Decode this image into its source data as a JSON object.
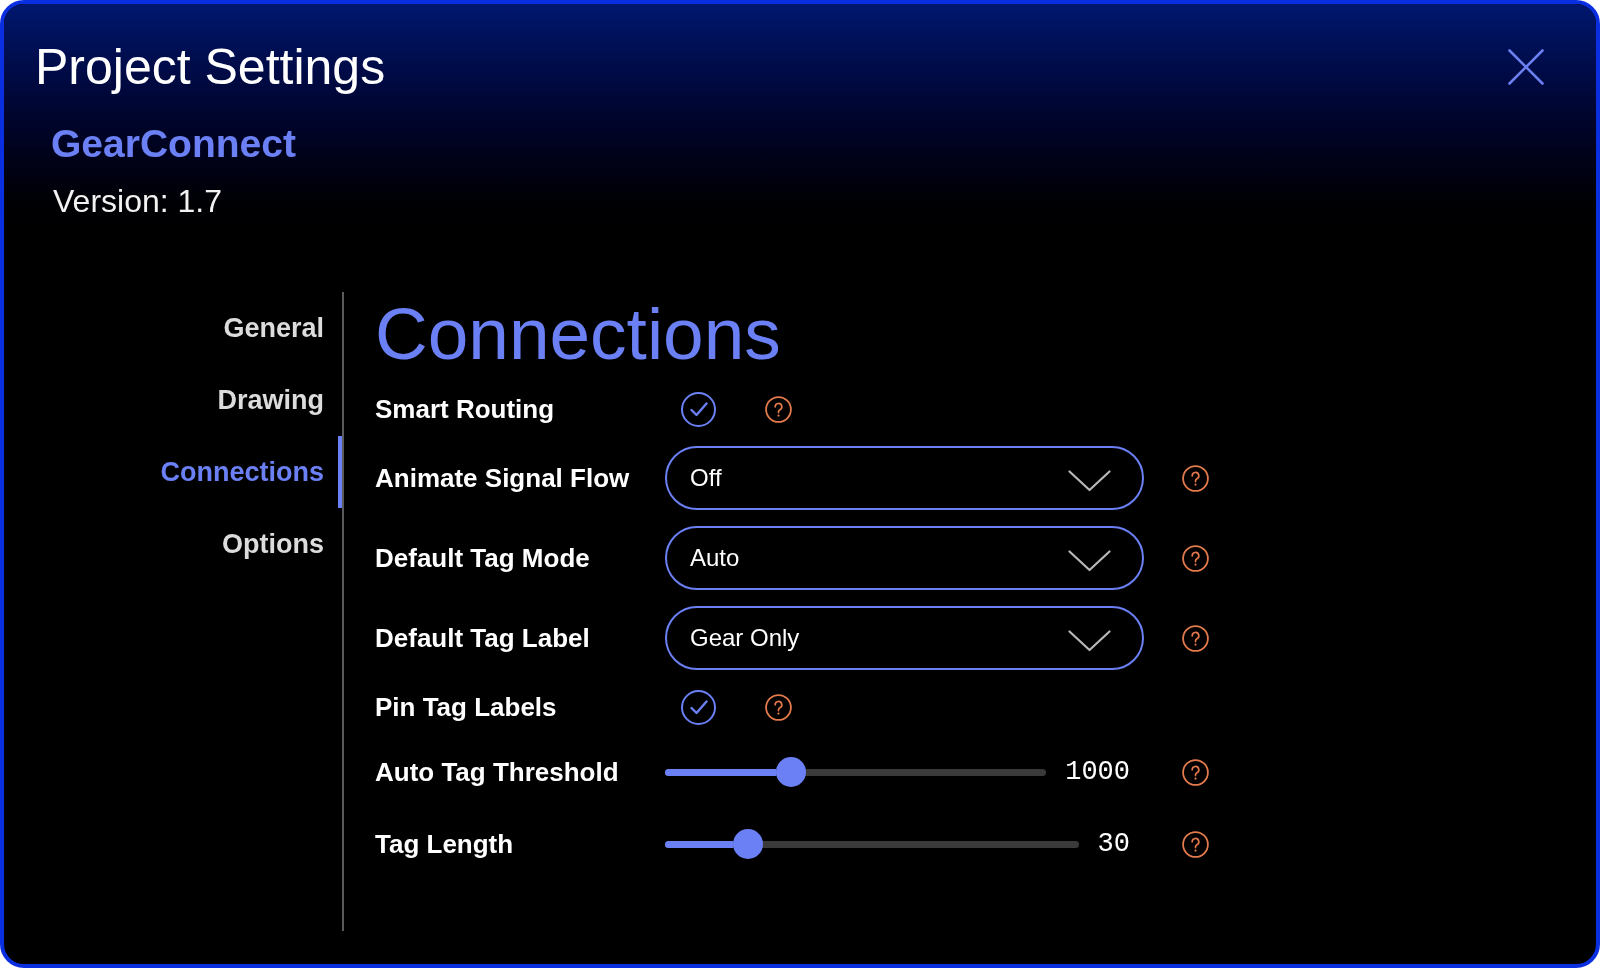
{
  "window": {
    "title": "Project Settings"
  },
  "project": {
    "name": "GearConnect",
    "version": "Version: 1.7"
  },
  "sidebar": {
    "items": [
      {
        "label": "General",
        "selected": false
      },
      {
        "label": "Drawing",
        "selected": false
      },
      {
        "label": "Connections",
        "selected": true
      },
      {
        "label": "Options",
        "selected": false
      }
    ]
  },
  "section": {
    "title": "Connections",
    "settings": [
      {
        "kind": "checkbox",
        "label": "Smart Routing",
        "checked": true
      },
      {
        "kind": "dropdown",
        "label": "Animate Signal Flow",
        "value": "Off"
      },
      {
        "kind": "dropdown",
        "label": "Default Tag Mode",
        "value": "Auto"
      },
      {
        "kind": "dropdown",
        "label": "Default Tag Label",
        "value": "Gear Only"
      },
      {
        "kind": "checkbox",
        "label": "Pin Tag Labels",
        "checked": true
      },
      {
        "kind": "slider",
        "label": "Auto Tag Threshold",
        "level": 0.33,
        "reading": "1000"
      },
      {
        "kind": "slider",
        "label": "Tag Length",
        "level": 0.2,
        "reading": "30"
      }
    ]
  }
}
